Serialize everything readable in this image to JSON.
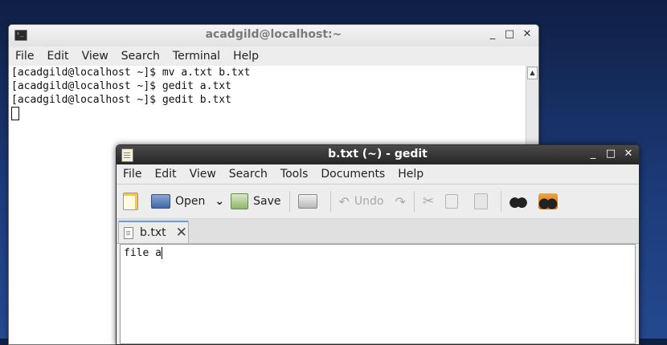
{
  "terminal": {
    "title": "acadgild@localhost:~",
    "menu": [
      "File",
      "Edit",
      "View",
      "Search",
      "Terminal",
      "Help"
    ],
    "lines": [
      "[acadgild@localhost ~]$ mv a.txt b.txt",
      "[acadgild@localhost ~]$ gedit a.txt",
      "[acadgild@localhost ~]$ gedit b.txt"
    ],
    "controls": {
      "minimize": "_",
      "maximize": "□",
      "close": "✕"
    }
  },
  "gedit": {
    "title": "b.txt (~) - gedit",
    "menu": [
      "File",
      "Edit",
      "View",
      "Search",
      "Tools",
      "Documents",
      "Help"
    ],
    "toolbar": {
      "open_label": "Open",
      "open_arrow": "⌄",
      "save_label": "Save",
      "undo_label": "Undo"
    },
    "tab": {
      "label": "b.txt",
      "close": "✕"
    },
    "content": "file a",
    "controls": {
      "minimize": "_",
      "maximize": "□",
      "close": "✕"
    }
  },
  "colors": {
    "desktop": "#1c3a78",
    "gedit_titlebar": "#2f2f2f",
    "tab_accent": "#6a9fd6"
  }
}
